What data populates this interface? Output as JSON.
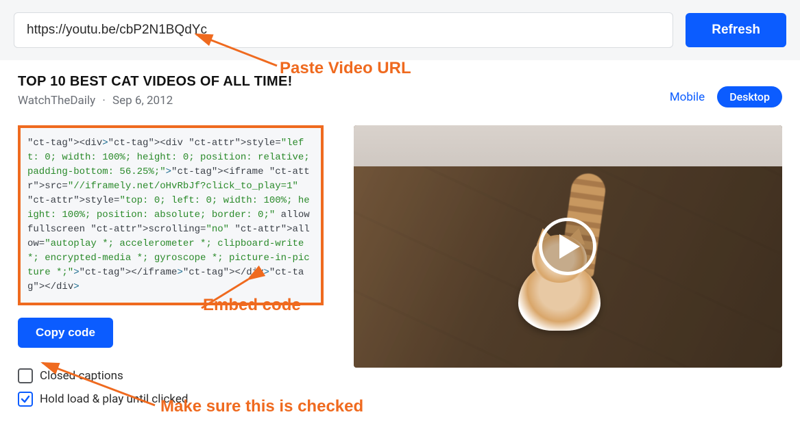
{
  "topbar": {
    "url_value": "https://youtu.be/cbP2N1BQdYc",
    "refresh_label": "Refresh"
  },
  "video": {
    "title": "TOP 10 BEST CAT VIDEOS OF ALL TIME!",
    "channel": "WatchTheDaily",
    "sep": "·",
    "date": "Sep 6, 2012"
  },
  "view": {
    "mobile_label": "Mobile",
    "desktop_label": "Desktop"
  },
  "embed_code": "<div><div style=\"left: 0; width: 100%; height: 0; position: relative; padding-bottom: 56.25%;\"><iframe src=\"//iframely.net/oHvRbJf?click_to_play=1\" style=\"top: 0; left: 0; width: 100%; height: 100%; position: absolute; border: 0;\" allowfullscreen scrolling=\"no\" allow=\"autoplay *; accelerometer *; clipboard-write *; encrypted-media *; gyroscope *; picture-in-picture *;\"></iframe></div></div>",
  "buttons": {
    "copy_code": "Copy code"
  },
  "options": {
    "closed_captions": {
      "label": "Closed captions",
      "checked": false
    },
    "hold_load": {
      "label": "Hold load & play until clicked",
      "checked": true
    }
  },
  "annotations": {
    "paste_url": "Paste Video URL",
    "embed_code": "Embed code",
    "make_sure": "Make sure this is checked"
  },
  "colors": {
    "accent": "#0b5cff",
    "annotation": "#ef6a1f"
  }
}
